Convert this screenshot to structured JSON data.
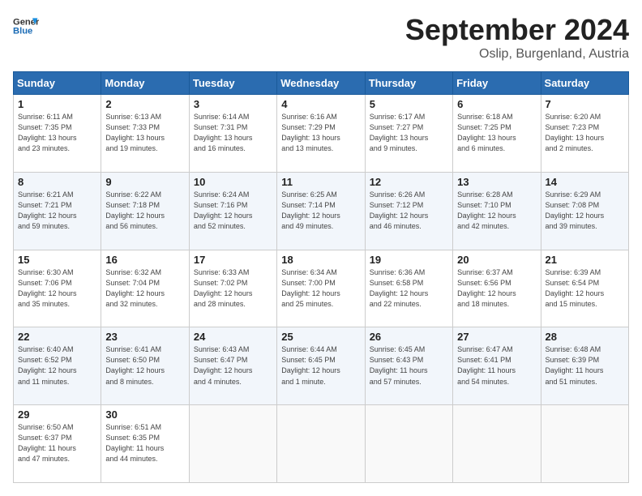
{
  "header": {
    "logo_line1": "General",
    "logo_line2": "Blue",
    "month_title": "September 2024",
    "location": "Oslip, Burgenland, Austria"
  },
  "weekdays": [
    "Sunday",
    "Monday",
    "Tuesday",
    "Wednesday",
    "Thursday",
    "Friday",
    "Saturday"
  ],
  "weeks": [
    [
      {
        "day": "1",
        "info": "Sunrise: 6:11 AM\nSunset: 7:35 PM\nDaylight: 13 hours\nand 23 minutes."
      },
      {
        "day": "2",
        "info": "Sunrise: 6:13 AM\nSunset: 7:33 PM\nDaylight: 13 hours\nand 19 minutes."
      },
      {
        "day": "3",
        "info": "Sunrise: 6:14 AM\nSunset: 7:31 PM\nDaylight: 13 hours\nand 16 minutes."
      },
      {
        "day": "4",
        "info": "Sunrise: 6:16 AM\nSunset: 7:29 PM\nDaylight: 13 hours\nand 13 minutes."
      },
      {
        "day": "5",
        "info": "Sunrise: 6:17 AM\nSunset: 7:27 PM\nDaylight: 13 hours\nand 9 minutes."
      },
      {
        "day": "6",
        "info": "Sunrise: 6:18 AM\nSunset: 7:25 PM\nDaylight: 13 hours\nand 6 minutes."
      },
      {
        "day": "7",
        "info": "Sunrise: 6:20 AM\nSunset: 7:23 PM\nDaylight: 13 hours\nand 2 minutes."
      }
    ],
    [
      {
        "day": "8",
        "info": "Sunrise: 6:21 AM\nSunset: 7:21 PM\nDaylight: 12 hours\nand 59 minutes."
      },
      {
        "day": "9",
        "info": "Sunrise: 6:22 AM\nSunset: 7:18 PM\nDaylight: 12 hours\nand 56 minutes."
      },
      {
        "day": "10",
        "info": "Sunrise: 6:24 AM\nSunset: 7:16 PM\nDaylight: 12 hours\nand 52 minutes."
      },
      {
        "day": "11",
        "info": "Sunrise: 6:25 AM\nSunset: 7:14 PM\nDaylight: 12 hours\nand 49 minutes."
      },
      {
        "day": "12",
        "info": "Sunrise: 6:26 AM\nSunset: 7:12 PM\nDaylight: 12 hours\nand 46 minutes."
      },
      {
        "day": "13",
        "info": "Sunrise: 6:28 AM\nSunset: 7:10 PM\nDaylight: 12 hours\nand 42 minutes."
      },
      {
        "day": "14",
        "info": "Sunrise: 6:29 AM\nSunset: 7:08 PM\nDaylight: 12 hours\nand 39 minutes."
      }
    ],
    [
      {
        "day": "15",
        "info": "Sunrise: 6:30 AM\nSunset: 7:06 PM\nDaylight: 12 hours\nand 35 minutes."
      },
      {
        "day": "16",
        "info": "Sunrise: 6:32 AM\nSunset: 7:04 PM\nDaylight: 12 hours\nand 32 minutes."
      },
      {
        "day": "17",
        "info": "Sunrise: 6:33 AM\nSunset: 7:02 PM\nDaylight: 12 hours\nand 28 minutes."
      },
      {
        "day": "18",
        "info": "Sunrise: 6:34 AM\nSunset: 7:00 PM\nDaylight: 12 hours\nand 25 minutes."
      },
      {
        "day": "19",
        "info": "Sunrise: 6:36 AM\nSunset: 6:58 PM\nDaylight: 12 hours\nand 22 minutes."
      },
      {
        "day": "20",
        "info": "Sunrise: 6:37 AM\nSunset: 6:56 PM\nDaylight: 12 hours\nand 18 minutes."
      },
      {
        "day": "21",
        "info": "Sunrise: 6:39 AM\nSunset: 6:54 PM\nDaylight: 12 hours\nand 15 minutes."
      }
    ],
    [
      {
        "day": "22",
        "info": "Sunrise: 6:40 AM\nSunset: 6:52 PM\nDaylight: 12 hours\nand 11 minutes."
      },
      {
        "day": "23",
        "info": "Sunrise: 6:41 AM\nSunset: 6:50 PM\nDaylight: 12 hours\nand 8 minutes."
      },
      {
        "day": "24",
        "info": "Sunrise: 6:43 AM\nSunset: 6:47 PM\nDaylight: 12 hours\nand 4 minutes."
      },
      {
        "day": "25",
        "info": "Sunrise: 6:44 AM\nSunset: 6:45 PM\nDaylight: 12 hours\nand 1 minute."
      },
      {
        "day": "26",
        "info": "Sunrise: 6:45 AM\nSunset: 6:43 PM\nDaylight: 11 hours\nand 57 minutes."
      },
      {
        "day": "27",
        "info": "Sunrise: 6:47 AM\nSunset: 6:41 PM\nDaylight: 11 hours\nand 54 minutes."
      },
      {
        "day": "28",
        "info": "Sunrise: 6:48 AM\nSunset: 6:39 PM\nDaylight: 11 hours\nand 51 minutes."
      }
    ],
    [
      {
        "day": "29",
        "info": "Sunrise: 6:50 AM\nSunset: 6:37 PM\nDaylight: 11 hours\nand 47 minutes."
      },
      {
        "day": "30",
        "info": "Sunrise: 6:51 AM\nSunset: 6:35 PM\nDaylight: 11 hours\nand 44 minutes."
      },
      {
        "day": "",
        "info": ""
      },
      {
        "day": "",
        "info": ""
      },
      {
        "day": "",
        "info": ""
      },
      {
        "day": "",
        "info": ""
      },
      {
        "day": "",
        "info": ""
      }
    ]
  ]
}
